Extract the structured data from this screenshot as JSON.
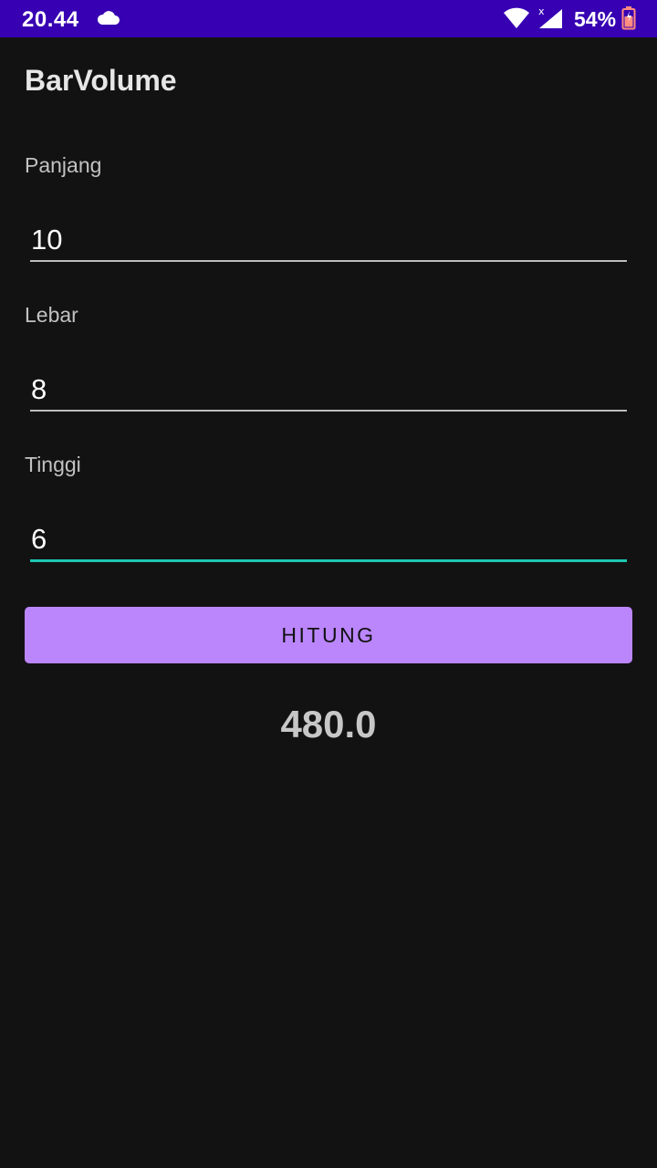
{
  "status_bar": {
    "time": "20.44",
    "battery": "54%",
    "icons": [
      "cloud-icon",
      "wifi-icon",
      "signal-icon",
      "battery-icon"
    ],
    "background": "#3700b3"
  },
  "app": {
    "title": "BarVolume"
  },
  "form": {
    "panjang": {
      "label": "Panjang",
      "value": "10"
    },
    "lebar": {
      "label": "Lebar",
      "value": "8"
    },
    "tinggi": {
      "label": "Tinggi",
      "value": "6"
    }
  },
  "button": {
    "label": "HITUNG",
    "color": "#bb86fc"
  },
  "result": {
    "value": "480.0"
  },
  "colors": {
    "background": "#121212",
    "focus_accent": "#1dc8b0"
  }
}
